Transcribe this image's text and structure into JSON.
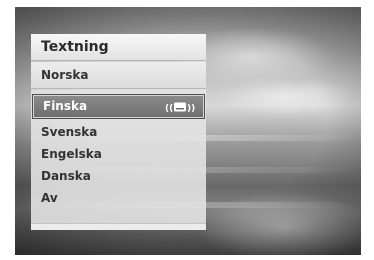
{
  "menu": {
    "title": "Textning",
    "current": "Norska",
    "options": [
      {
        "label": "Finska",
        "selected": true
      },
      {
        "label": "Svenska",
        "selected": false
      },
      {
        "label": "Engelska",
        "selected": false
      },
      {
        "label": "Danska",
        "selected": false
      },
      {
        "label": "Av",
        "selected": false
      }
    ],
    "selected_icon": "subtitle-icon"
  },
  "colors": {
    "highlight": "#7a7a7a",
    "text": "#333333"
  }
}
